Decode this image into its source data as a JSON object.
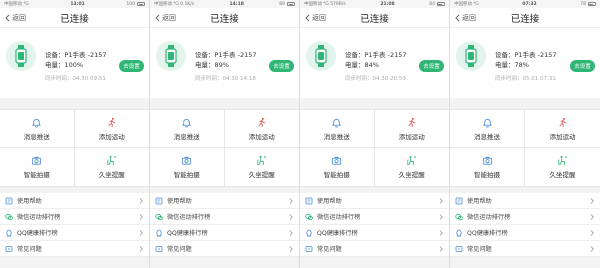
{
  "screens": [
    {
      "status": {
        "left": "中国移动 ⁴G",
        "time": "13:01",
        "right": "100"
      },
      "header": {
        "back_label": "返回",
        "title": "已连接"
      },
      "device": {
        "name": "设备：P1手表 -2157",
        "battery": "电量：100%",
        "sync": "同步时间：04.30 09:51",
        "button": "去设置"
      },
      "grid": [
        "消息推送",
        "添加运动",
        "智能拍摄",
        "久坐提醒"
      ],
      "list": [
        "使用帮助",
        "微信运动排行榜",
        "QQ健康排行榜",
        "常见问题"
      ]
    },
    {
      "status": {
        "left": "中国移动 ⁴G 0.1K/s",
        "time": "14:18",
        "right": "89"
      },
      "header": {
        "back_label": "返回",
        "title": "已连接"
      },
      "device": {
        "name": "设备：P1手表 -2157",
        "battery": "电量：89%",
        "sync": "同步时间：04.30 14:18",
        "button": "去设置"
      },
      "grid": [
        "消息推送",
        "添加运动",
        "智能拍摄",
        "久坐提醒"
      ],
      "list": [
        "使用帮助",
        "微信运动排行榜",
        "QQ健康排行榜",
        "常见问题"
      ]
    },
    {
      "status": {
        "left": "中国移动 ⁴G 579B/s",
        "time": "21:08",
        "right": "84"
      },
      "header": {
        "back_label": "返回",
        "title": "已连接"
      },
      "device": {
        "name": "设备：P1手表 -2157",
        "battery": "电量：84%",
        "sync": "同步时间：04.30 20:59",
        "button": "去设置"
      },
      "grid": [
        "消息推送",
        "添加运动",
        "智能拍摄",
        "久坐提醒"
      ],
      "list": [
        "使用帮助",
        "微信运动排行榜",
        "QQ健康排行榜",
        "常见问题"
      ]
    },
    {
      "status": {
        "left": "中国移动 ⁴G",
        "time": "07:32",
        "right": "78"
      },
      "header": {
        "back_label": "返回",
        "title": "已连接"
      },
      "device": {
        "name": "设备：P1手表 -2157",
        "battery": "电量：78%",
        "sync": "同步时间：05.01 07:31",
        "button": "去设置"
      },
      "grid": [
        "消息推送",
        "添加运动",
        "智能拍摄",
        "久坐提醒"
      ],
      "list": [
        "使用帮助",
        "微信运动排行榜",
        "QQ健康排行榜",
        "常见问题"
      ]
    }
  ],
  "colors": {
    "accent": "#2fb574",
    "watch_bg": "#e3f4ec",
    "icon_blue": "#4a8fd8",
    "icon_red": "#e0524b",
    "icon_green": "#2fb574"
  },
  "icons": {
    "grid": [
      "bell-icon",
      "running-icon",
      "camera-icon",
      "sitting-icon"
    ],
    "list": [
      "help-icon",
      "wechat-icon",
      "qq-icon",
      "faq-icon"
    ]
  }
}
